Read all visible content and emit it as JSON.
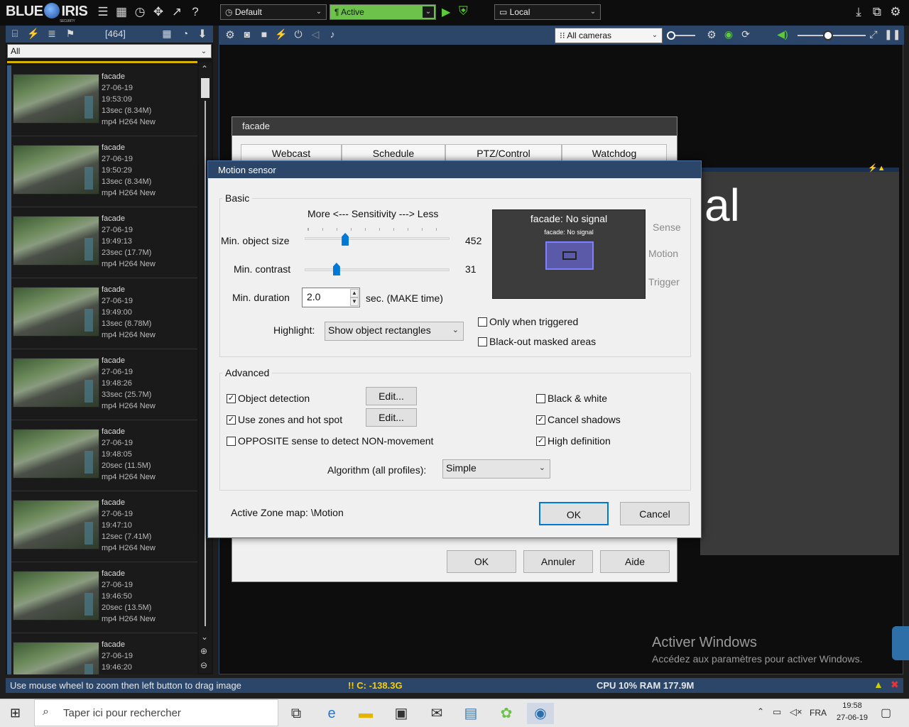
{
  "app": {
    "logo": "BLUE IRIS",
    "logo_sub": "SECURITY"
  },
  "topbar": {
    "profile": "Default",
    "schedule": "Active",
    "location": "Local"
  },
  "leftpanel": {
    "count": "[464]",
    "filter": "All"
  },
  "clips": [
    {
      "camera": "facade",
      "date": "27-06-19",
      "time": "19:53:09",
      "size": "13sec (8.34M)",
      "codec": "mp4 H264 New"
    },
    {
      "camera": "facade",
      "date": "27-06-19",
      "time": "19:50:29",
      "size": "13sec (8.34M)",
      "codec": "mp4 H264 New"
    },
    {
      "camera": "facade",
      "date": "27-06-19",
      "time": "19:49:13",
      "size": "23sec (17.7M)",
      "codec": "mp4 H264 New"
    },
    {
      "camera": "facade",
      "date": "27-06-19",
      "time": "19:49:00",
      "size": "13sec (8.78M)",
      "codec": "mp4 H264 New"
    },
    {
      "camera": "facade",
      "date": "27-06-19",
      "time": "19:48:26",
      "size": "33sec (25.7M)",
      "codec": "mp4 H264 New"
    },
    {
      "camera": "facade",
      "date": "27-06-19",
      "time": "19:48:05",
      "size": "20sec (11.5M)",
      "codec": "mp4 H264 New"
    },
    {
      "camera": "facade",
      "date": "27-06-19",
      "time": "19:47:10",
      "size": "12sec (7.41M)",
      "codec": "mp4 H264 New"
    },
    {
      "camera": "facade",
      "date": "27-06-19",
      "time": "19:46:50",
      "size": "20sec (13.5M)",
      "codec": "mp4 H264 New"
    },
    {
      "camera": "facade",
      "date": "27-06-19",
      "time": "19:46:20",
      "size": "",
      "codec": ""
    }
  ],
  "viewer": {
    "camera_select": "All cameras",
    "bg_text": "al"
  },
  "camdialog": {
    "title": "facade",
    "tabs": [
      "Webcast",
      "Schedule",
      "PTZ/Control",
      "Watchdog"
    ],
    "ok": "OK",
    "cancel": "Annuler",
    "help": "Aide"
  },
  "motion": {
    "title": "Motion sensor",
    "basic_label": "Basic",
    "sensitivity": "More <--- Sensitivity ---> Less",
    "min_object_label": "Min. object size",
    "min_object_value": "452",
    "min_object_level": 0.28,
    "min_contrast_label": "Min. contrast",
    "min_contrast_value": "31",
    "min_contrast_level": 0.22,
    "min_duration_label": "Min. duration",
    "min_duration_value": "2.0",
    "min_duration_unit": "sec.  (MAKE time)",
    "highlight_label": "Highlight:",
    "highlight_value": "Show object rectangles",
    "only_triggered": "Only when triggered",
    "blackout": "Black-out masked areas",
    "preview_title": "facade: No signal",
    "preview_sub": "facade: No signal",
    "sense": "Sense",
    "motion_lbl": "Motion",
    "trigger": "Trigger",
    "advanced_label": "Advanced",
    "object_detection": "Object detection",
    "edit1": "Edit...",
    "use_zones": "Use zones and hot spot",
    "edit2": "Edit...",
    "opposite": "OPPOSITE sense to detect NON-movement",
    "bw": "Black & white",
    "cancel_shadows": "Cancel shadows",
    "high_def": "High definition",
    "algorithm_label": "Algorithm (all profiles):",
    "algorithm_value": "Simple",
    "zone_map_label": "Active Zone map:  \\Motion",
    "ok": "OK",
    "cancel": "Cancel"
  },
  "watermark": {
    "line1": "Activer Windows",
    "line2": "Accédez aux paramètres pour activer Windows."
  },
  "status": {
    "hint": "Use mouse wheel to zoom then left button to drag image",
    "disk": "!! C: -138.3G",
    "cpu": "CPU 10% RAM 177.9M"
  },
  "taskbar": {
    "search": "Taper ici pour rechercher",
    "lang": "FRA",
    "time": "19:58",
    "date": "27-06-19"
  }
}
